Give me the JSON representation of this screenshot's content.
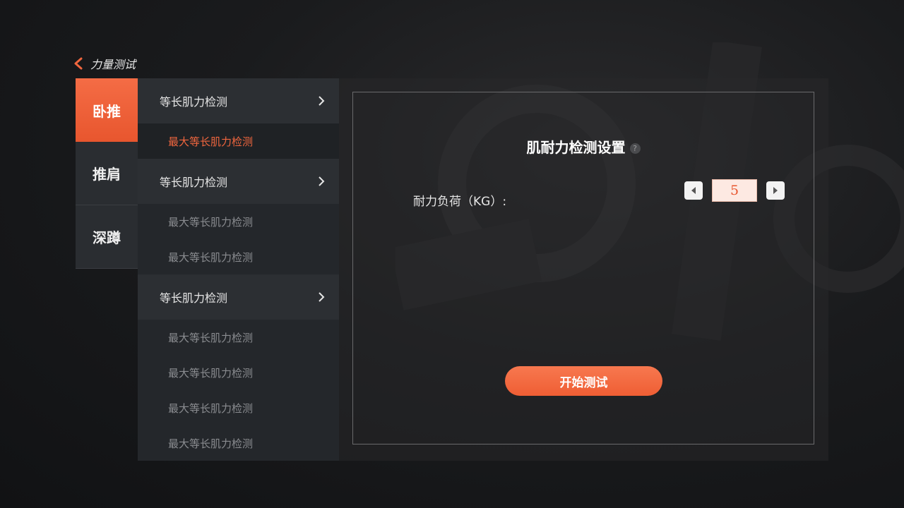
{
  "header": {
    "title": "力量测试"
  },
  "categories": [
    {
      "label": "卧推",
      "active": true
    },
    {
      "label": "推肩",
      "active": false
    },
    {
      "label": "深蹲",
      "active": false
    }
  ],
  "groups": [
    {
      "title": "等长肌力检测",
      "items": [
        "最大等长肌力检测"
      ]
    },
    {
      "title": "等长肌力检测",
      "items": [
        "最大等长肌力检测",
        "最大等长肌力检测"
      ]
    },
    {
      "title": "等长肌力检测",
      "items": [
        "最大等长肌力检测",
        "最大等长肌力检测",
        "最大等长肌力检测",
        "最大等长肌力检测"
      ]
    }
  ],
  "panel": {
    "title": "肌耐力检测设置",
    "help_glyph": "?",
    "load_label": "耐力负荷（KG）:",
    "load_value": "5",
    "start_label": "开始测试"
  },
  "colors": {
    "accent": "#f0663e",
    "accent_dark": "#e8562e"
  }
}
